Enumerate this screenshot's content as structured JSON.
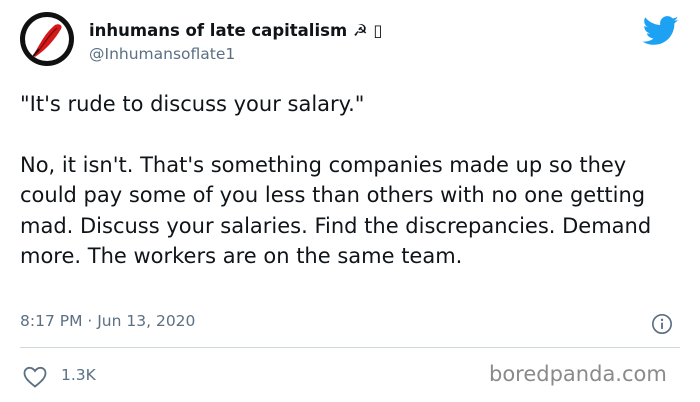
{
  "author": {
    "display_name": "inhumans of late capitalism ☭ ▯",
    "handle": "@Inhumansoflate1",
    "avatar_icon": "red-feather-avatar"
  },
  "tweet": {
    "paragraphs": [
      "\"It's rude to discuss your salary.\"",
      "No, it isn't. That's something companies made up so they could pay some of you less than others with no one getting mad. Discuss your salaries. Find the discrepancies. Demand more. The workers are on the same team."
    ],
    "timestamp": "8:17 PM · Jun 13, 2020"
  },
  "engagement": {
    "likes": "1.3K"
  },
  "watermark": "boredpanda.com",
  "colors": {
    "twitter_blue": "#1da1f2",
    "secondary_text": "#5b7083",
    "text": "#0f1419"
  }
}
